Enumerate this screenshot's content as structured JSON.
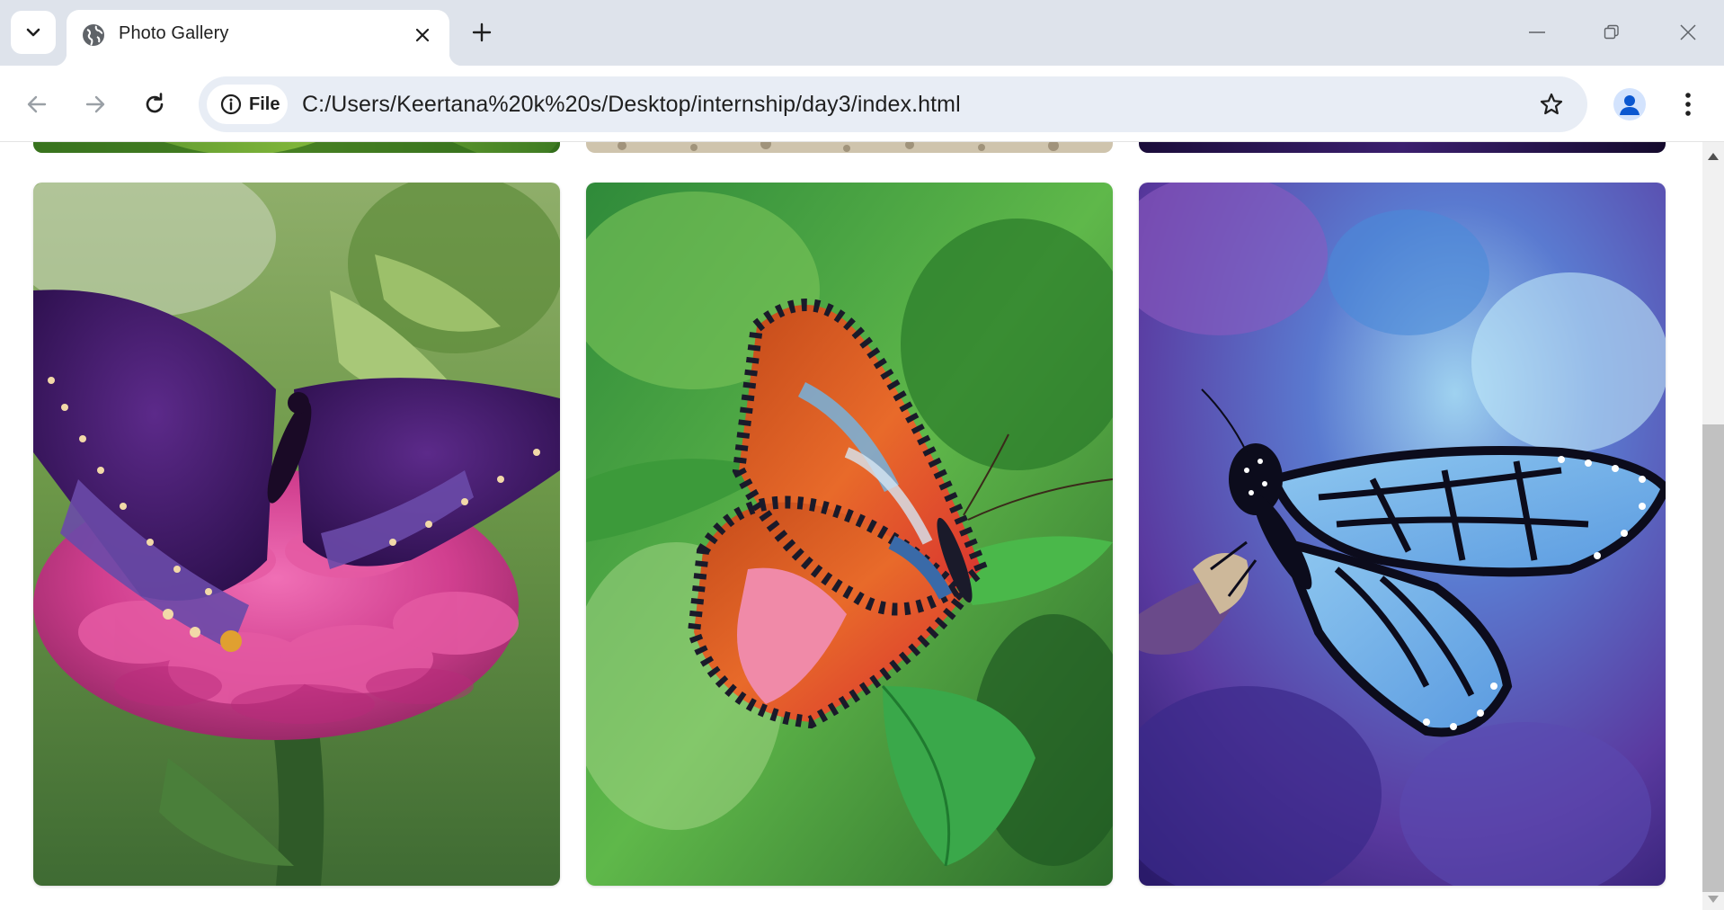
{
  "browser": {
    "tab": {
      "title": "Photo Gallery",
      "favicon": "globe-icon",
      "close_icon": "close-icon"
    },
    "tab_search_icon": "chevron-down-icon",
    "new_tab_icon": "plus-icon",
    "window_controls": [
      "minimize-icon",
      "restore-icon",
      "close-icon"
    ],
    "toolbar": {
      "back_icon": "arrow-left-icon",
      "forward_icon": "arrow-right-icon",
      "reload_icon": "reload-icon",
      "site_info_icon": "info-icon",
      "site_chip_label": "File",
      "url": "C:/Users/Keertana%20k%20s/Desktop/internship/day3/index.html",
      "bookmark_icon": "star-icon",
      "profile_icon": "person-icon",
      "menu_icon": "kebab-menu-icon"
    },
    "colors": {
      "tabstrip_bg": "#dee3eb",
      "omnibox_bg": "#e8edf5",
      "profile_accent": "#0b57d0"
    }
  },
  "gallery": {
    "previous_row": [
      "green-foliage-photo",
      "gravel-photo",
      "dark-purple-photo"
    ],
    "current_row": [
      {
        "image": "purple-butterfly-on-pink-zinnia-photo"
      },
      {
        "image": "orange-red-butterfly-on-leaf-photo"
      },
      {
        "image": "blue-monarch-butterfly-photo"
      }
    ]
  },
  "scrollbar": {
    "position": "near-bottom"
  }
}
